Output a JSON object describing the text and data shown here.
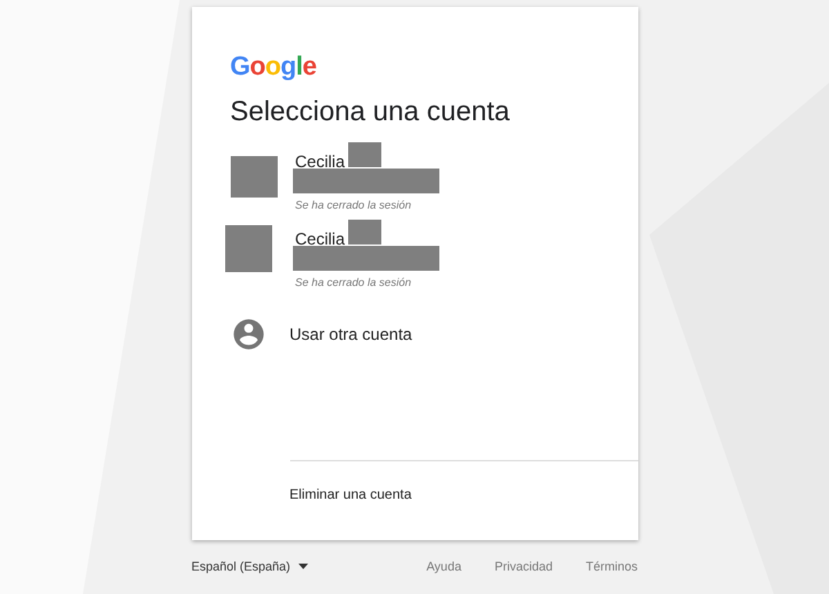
{
  "logo": "Google",
  "title": "Selecciona una cuenta",
  "accounts": [
    {
      "name": "Cecilia",
      "status": "Se ha cerrado la sesión"
    },
    {
      "name": "Cecilia",
      "status": "Se ha cerrado la sesión"
    }
  ],
  "other_account": "Usar otra cuenta",
  "remove_account": "Eliminar una cuenta",
  "footer": {
    "language": "Español (España)",
    "links": [
      "Ayuda",
      "Privacidad",
      "Términos"
    ]
  }
}
